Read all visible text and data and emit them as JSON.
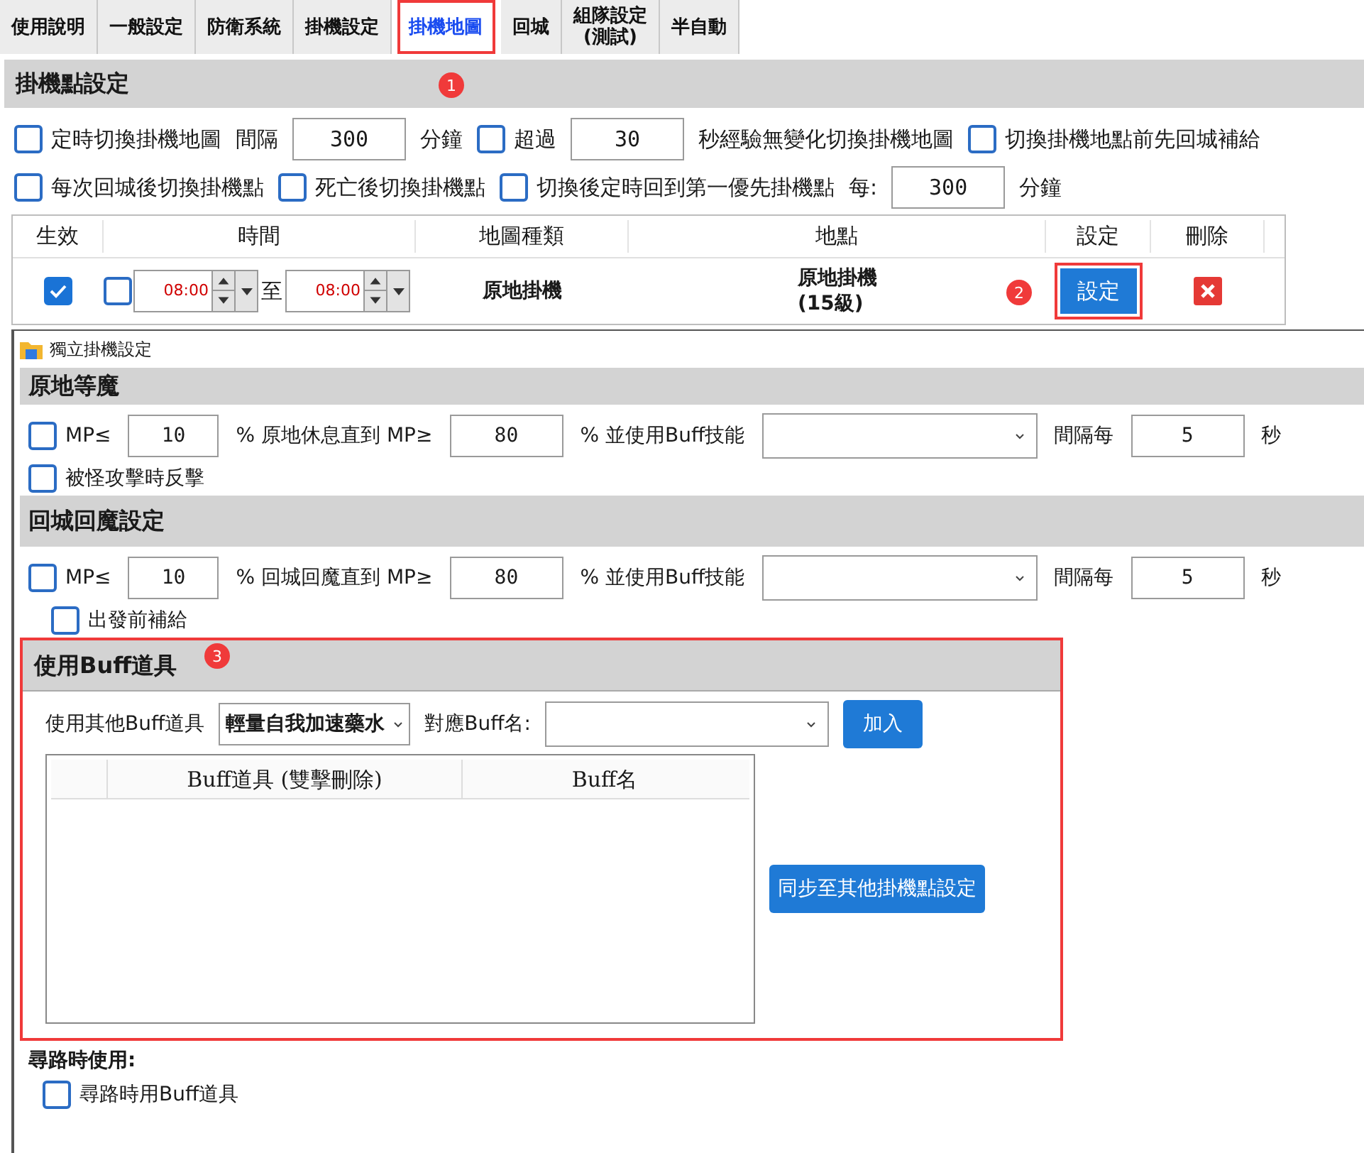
{
  "annotations": [
    {
      "label": "1"
    },
    {
      "label": "2"
    },
    {
      "label": "3"
    }
  ],
  "tabs": [
    {
      "label": "使用說明",
      "selected": false
    },
    {
      "label": "一般設定",
      "selected": false
    },
    {
      "label": "防衛系統",
      "selected": false
    },
    {
      "label": "掛機設定",
      "selected": false
    },
    {
      "label": "掛機地圖",
      "selected": true
    },
    {
      "label": "回城",
      "selected": false
    },
    {
      "label": "組隊設定\n(測試)",
      "selected": false
    },
    {
      "label": "半自動",
      "selected": false
    }
  ],
  "main": {
    "section_title": "掛機點設定",
    "option_rows": [
      [
        {
          "kind": "checkbox",
          "label": "定時切換掛機地圖",
          "checked": false
        },
        {
          "kind": "text",
          "label": "間隔"
        },
        {
          "kind": "input",
          "value": "300"
        },
        {
          "kind": "text",
          "label": "分鐘"
        },
        {
          "kind": "checkbox",
          "label": "超過",
          "checked": false
        },
        {
          "kind": "input",
          "value": "30"
        },
        {
          "kind": "text",
          "label": "秒經驗無變化切換掛機地圖"
        },
        {
          "kind": "checkbox",
          "label": "切換掛機地點前先回城補給",
          "checked": false
        }
      ],
      [
        {
          "kind": "checkbox",
          "label": "每次回城後切換掛機點",
          "checked": false
        },
        {
          "kind": "checkbox",
          "label": "死亡後切換掛機點",
          "checked": false
        },
        {
          "kind": "checkbox",
          "label": "切換後定時回到第一優先掛機點",
          "checked": false
        },
        {
          "kind": "text",
          "label": "每:"
        },
        {
          "kind": "input",
          "value": "300"
        },
        {
          "kind": "text",
          "label": "分鐘"
        }
      ]
    ],
    "table": {
      "columns": [
        "生效",
        "時間",
        "地圖種類",
        "地點",
        "設定",
        "刪除"
      ],
      "rows": [
        {
          "enabled": true,
          "time_enabled": false,
          "start": "08:00",
          "separator": "至",
          "end": "08:00",
          "map_type": "原地掛機",
          "location": [
            "原地掛機",
            "(15級)"
          ],
          "settings_button": "設定"
        }
      ]
    }
  },
  "dialog": {
    "title": "獨立掛機設定",
    "sections": [
      {
        "title": "原地等魔",
        "rows": [
          [
            {
              "kind": "checkbox",
              "label": "MP≤",
              "checked": false
            },
            {
              "kind": "input",
              "value": "10"
            },
            {
              "kind": "text",
              "label": "% 原地休息直到 MP≥"
            },
            {
              "kind": "input",
              "value": "80"
            },
            {
              "kind": "text",
              "label": "% 並使用Buff技能"
            },
            {
              "kind": "select"
            },
            {
              "kind": "text",
              "label": "間隔每"
            },
            {
              "kind": "input",
              "value": "5"
            },
            {
              "kind": "text",
              "label": "秒"
            }
          ],
          [
            {
              "kind": "checkbox",
              "label": "被怪攻擊時反擊",
              "checked": false
            }
          ]
        ]
      },
      {
        "title": "回城回魔設定",
        "rows": [
          [
            {
              "kind": "checkbox",
              "label": "MP≤",
              "checked": false
            },
            {
              "kind": "input",
              "value": "10"
            },
            {
              "kind": "text",
              "label": "% 回城回魔直到 MP≥"
            },
            {
              "kind": "input",
              "value": "80"
            },
            {
              "kind": "text",
              "label": "% 並使用Buff技能"
            },
            {
              "kind": "select"
            },
            {
              "kind": "text",
              "label": "間隔每"
            },
            {
              "kind": "input",
              "value": "5"
            },
            {
              "kind": "text",
              "label": "秒"
            }
          ],
          [
            {
              "kind": "checkbox",
              "label": "出發前補給",
              "checked": false
            }
          ]
        ]
      }
    ],
    "buff": {
      "title": "使用Buff道具",
      "item_label": "使用其他Buff道具",
      "item_value": "輕量自我加速藥水",
      "name_label": "對應Buff名:",
      "add_button": "加入",
      "columns": [
        "Buff道具 (雙擊刪除)",
        "Buff名"
      ],
      "sync_button": "同步至其他掛機點設定"
    },
    "pathing": {
      "title": "尋路時使用:",
      "checkbox": {
        "label": "尋路時用Buff道具",
        "checked": false
      }
    }
  }
}
